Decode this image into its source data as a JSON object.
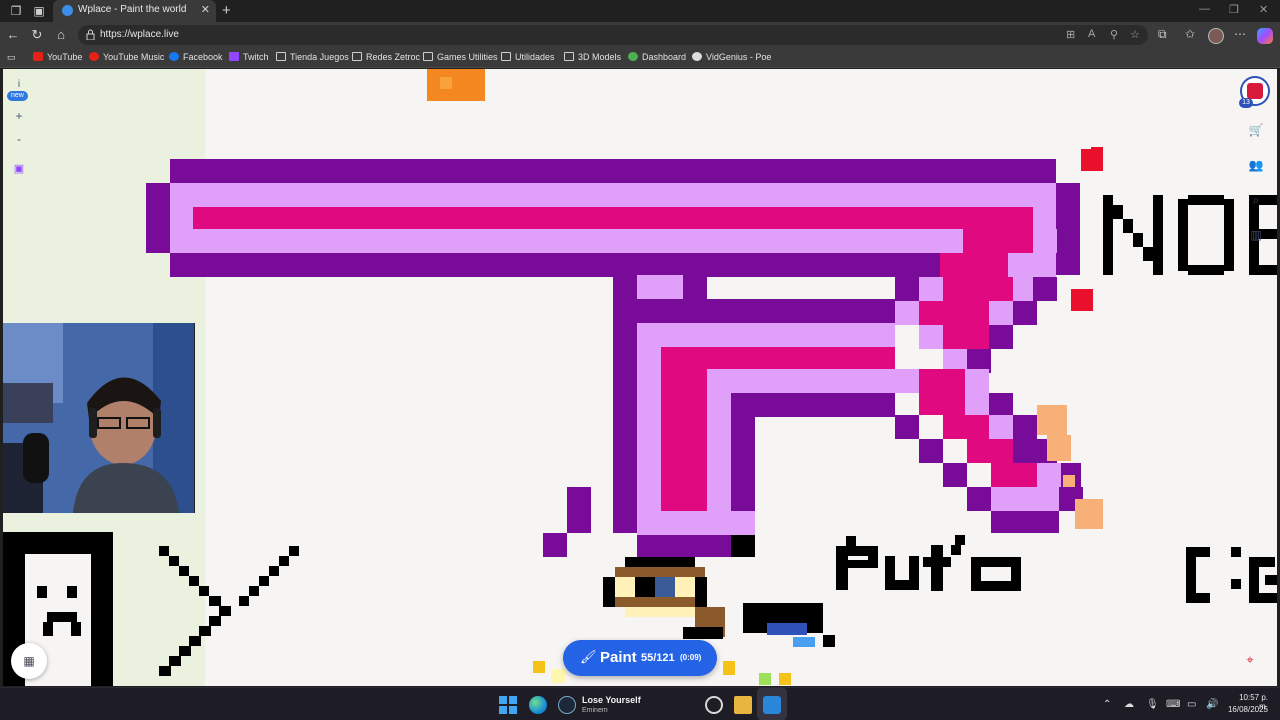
{
  "browser": {
    "tab_title": "Wplace - Paint the world",
    "url": "https://wplace.live",
    "new_tab_icon": "plus-icon",
    "close_tab_icon": "close-icon"
  },
  "bookmarks": [
    {
      "label": "YouTube",
      "icon": "youtube-icon",
      "color": "#e62117"
    },
    {
      "label": "YouTube Music",
      "icon": "youtube-music-icon",
      "color": "#e62117"
    },
    {
      "label": "Facebook",
      "icon": "facebook-icon",
      "color": "#1877f2"
    },
    {
      "label": "Twitch",
      "icon": "twitch-icon",
      "color": "#9146ff"
    },
    {
      "label": "Tienda Juegos",
      "icon": "folder-icon"
    },
    {
      "label": "Redes Zetroc",
      "icon": "folder-icon"
    },
    {
      "label": "Games Utilities",
      "icon": "folder-icon"
    },
    {
      "label": "Utilidades",
      "icon": "folder-icon"
    },
    {
      "label": "3D Models",
      "icon": "folder-icon"
    },
    {
      "label": "Dashboard",
      "icon": "dashboard-icon",
      "color": "#4caf50"
    },
    {
      "label": "VidGenius - Poe",
      "icon": "poe-icon"
    }
  ],
  "wplace": {
    "left_controls": {
      "info": "i",
      "new_badge": "new",
      "zoom_in": "+",
      "zoom_out": "-"
    },
    "logo_badge": "13",
    "paint_button": {
      "label": "Paint",
      "count": "55/121",
      "timer": "(0:09)"
    },
    "canvas_text": [
      "Puto",
      "NOB"
    ]
  },
  "taskbar": {
    "now_playing_title": "Lose Yourself",
    "now_playing_artist": "Eminem",
    "time": "10:57 p. m.",
    "date": "16/08/2025"
  },
  "colors": {
    "dark_purple": "#780c99",
    "light_purple": "#e09ff9",
    "magenta": "#e0097f",
    "red": "#e8102a",
    "orange": "#f58720",
    "peach": "#f7b077",
    "paint_blue": "#2463e6"
  }
}
